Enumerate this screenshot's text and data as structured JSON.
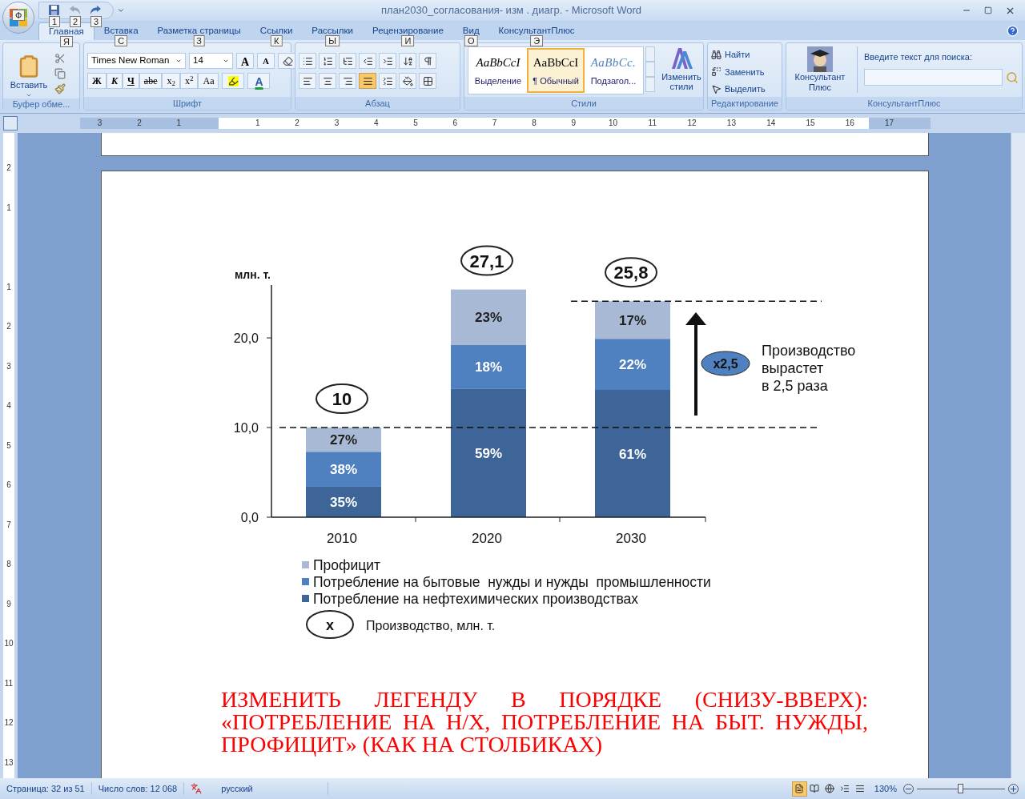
{
  "window": {
    "title": "план2030_согласования- изм . диагр. - Microsoft Word"
  },
  "office_button": {
    "keytip": "Ф"
  },
  "quick_access": [
    {
      "kind": "save",
      "keytip": "1"
    },
    {
      "kind": "undo",
      "keytip": "2"
    },
    {
      "kind": "redo",
      "keytip": "3"
    }
  ],
  "tabs": [
    {
      "label": "Главная",
      "keytip": "Я",
      "selected": true
    },
    {
      "label": "Вставка",
      "keytip": "С",
      "selected": false
    },
    {
      "label": "Разметка страницы",
      "keytip": "З",
      "selected": false
    },
    {
      "label": "Ссылки",
      "keytip": "К",
      "selected": false
    },
    {
      "label": "Рассылки",
      "keytip": "Ы",
      "selected": false
    },
    {
      "label": "Рецензирование",
      "keytip": "И",
      "selected": false
    },
    {
      "label": "Вид",
      "keytip": "О",
      "selected": false
    },
    {
      "label": "КонсультантПлюс",
      "keytip": "Э",
      "selected": false
    }
  ],
  "clipboard": {
    "paste": "Вставить",
    "label": "Буфер обме..."
  },
  "font": {
    "family": "Times New Roman",
    "size": "14",
    "grow": "A",
    "shrink": "A",
    "label": "Шрифт",
    "buttons": [
      {
        "kind": "bold",
        "text": "Ж"
      },
      {
        "kind": "italic",
        "text": "К"
      },
      {
        "kind": "underline",
        "text": "Ч"
      },
      {
        "kind": "strike",
        "text": "abe"
      },
      {
        "kind": "sub",
        "text": "x$_{2}$"
      },
      {
        "kind": "sup",
        "text": "x$^{2}$"
      },
      {
        "kind": "case",
        "text": "Aa"
      }
    ],
    "font_color": "A"
  },
  "paragraph": {
    "label": "Абзац",
    "align": [
      {
        "kind": "left",
        "selected": false
      },
      {
        "kind": "center",
        "selected": false
      },
      {
        "kind": "right",
        "selected": false
      },
      {
        "kind": "justify",
        "selected": true
      }
    ]
  },
  "styles": {
    "label": "Стили",
    "change": "Изменить стили",
    "items": [
      {
        "kind": "emphasis",
        "sample": "AaBbCcI",
        "name": "Выделение",
        "selected": false
      },
      {
        "kind": "normal",
        "sample": "AaBbCcI",
        "name": "¶ Обычный",
        "selected": true
      },
      {
        "kind": "subtitle",
        "sample": "AaBbCc.",
        "name": "Подзагол...",
        "selected": false
      }
    ]
  },
  "editing": {
    "label": "Редактирование",
    "items": [
      {
        "kind": "find",
        "label": "Найти"
      },
      {
        "kind": "replace",
        "label": "Заменить"
      },
      {
        "kind": "select",
        "label": "Выделить"
      }
    ]
  },
  "consultant": {
    "button": "Консультант Плюс",
    "search_label": "Введите текст для поиска:",
    "label": "КонсультантПлюс"
  },
  "horizontal_ruler": [
    "3",
    "2",
    "1",
    "1",
    "2",
    "3",
    "4",
    "5",
    "6",
    "7",
    "8",
    "9",
    "10",
    "11",
    "12",
    "13",
    "14",
    "15",
    "16",
    "17"
  ],
  "vertical_ruler": [
    "2",
    "1",
    "1",
    "2",
    "3",
    "4",
    "5",
    "6",
    "7",
    "8",
    "9",
    "10",
    "11",
    "12",
    "13"
  ],
  "document": {
    "chart": {
      "chart_data": {
        "type": "bar",
        "stacked": true,
        "ylabel": "млн. т.",
        "categories": [
          "2010",
          "2020",
          "2030"
        ],
        "ylim": [
          0,
          25.9
        ],
        "yticks": [
          {
            "value": 0,
            "label": "0,0"
          },
          {
            "value": 10,
            "label": "10,0"
          },
          {
            "value": 20,
            "label": "20,0"
          }
        ],
        "series": [
          {
            "name": "Потребление на нефтехимических производствах",
            "color": "#3e6597",
            "values": [
              3.4,
              14.3,
              14.2
            ]
          },
          {
            "name": "Потребление на бытовые  нужды и нужды  промышленности",
            "color": "#4f80bf",
            "values": [
              3.9,
              4.9,
              5.7
            ]
          },
          {
            "name": "Профицит",
            "color": "#a8b9d6",
            "values": [
              2.7,
              6.2,
              4.2
            ]
          }
        ],
        "legend": true,
        "ref_lines": [
          {
            "axis": "y",
            "value": 10
          },
          {
            "axis": "y",
            "value": 24.1
          }
        ],
        "annotations": [
          "35%",
          "38%",
          "27%",
          "59%",
          "18%",
          "23%",
          "61%",
          "22%",
          "17%"
        ]
      },
      "totals": [
        "10",
        "27,1",
        "25,8"
      ],
      "growth": {
        "badge": "x2,5",
        "lines": [
          "Производство",
          "вырастет",
          "в 2,5 раза"
        ]
      },
      "key": {
        "symbol": "x",
        "text": "Производство, млн. т."
      }
    },
    "note": "ИЗМЕНИТЬ ЛЕГЕНДУ В ПОРЯДКЕ (СНИЗУ-ВВЕРХ): «ПОТРЕБЛЕНИЕ НА Н/Х, ПОТРЕБЛЕНИЕ НА БЫТ. НУЖДЫ, ПРОФИЦИТ» (КАК НА СТОЛБИКАХ)"
  },
  "status_bar": {
    "page": "Страница: 32 из 51",
    "words": "Число слов: 12 068",
    "language": "русский",
    "zoom": "130%",
    "level": 0.5,
    "views": [
      {
        "kind": "print",
        "selected": true
      },
      {
        "kind": "reading",
        "selected": false
      },
      {
        "kind": "web",
        "selected": false
      },
      {
        "kind": "outline",
        "selected": false
      },
      {
        "kind": "draft",
        "selected": false
      }
    ]
  }
}
